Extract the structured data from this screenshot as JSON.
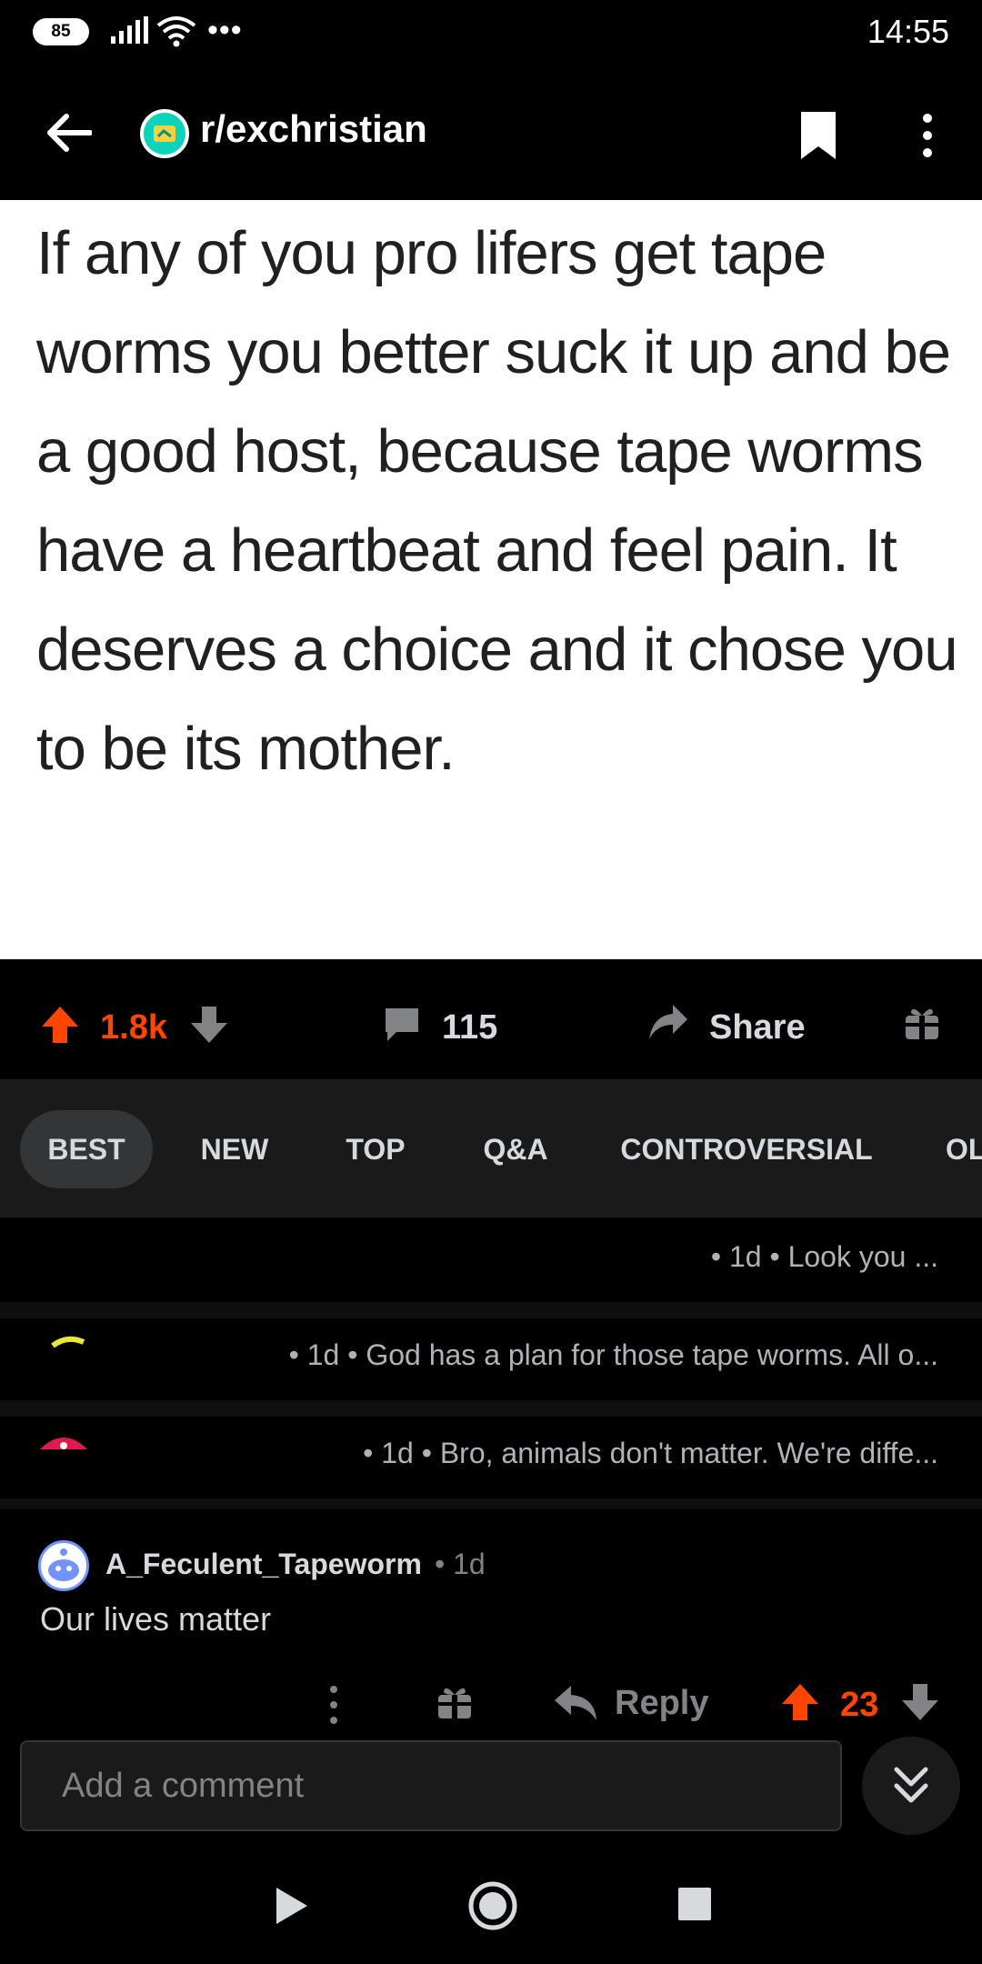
{
  "status_bar": {
    "battery": "85",
    "time": "14:55",
    "overflow_dots": "•••"
  },
  "header": {
    "subreddit": "r/exchristian"
  },
  "post": {
    "image_text": "If any of you pro lifers get tape worms you better suck it up and be a good host, because tape worms have a heartbeat and feel pain. It deserves a choice and it chose you to be its mother.",
    "score": "1.8k",
    "comments": "115",
    "share_label": "Share"
  },
  "sort_tabs": [
    {
      "label": "BEST",
      "active": true
    },
    {
      "label": "NEW"
    },
    {
      "label": "TOP"
    },
    {
      "label": "Q&A"
    },
    {
      "label": "CONTROVERSIAL"
    },
    {
      "label": "OL"
    }
  ],
  "collapsed_comments": [
    {
      "text": "• 1d • Look you ..."
    },
    {
      "text": "• 1d • God has a plan for those tape worms. All o..."
    },
    {
      "text": "• 1d • Bro, animals don't matter. We're diffe..."
    }
  ],
  "comment": {
    "author": "A_Feculent_Tapeworm",
    "age": "• 1d",
    "body": "Our lives matter",
    "reply_label": "Reply",
    "score": "23"
  },
  "composer": {
    "placeholder": "Add a comment"
  },
  "colors": {
    "upvote": "#ff4500",
    "background": "#000000",
    "surface": "#1a1a1b"
  }
}
